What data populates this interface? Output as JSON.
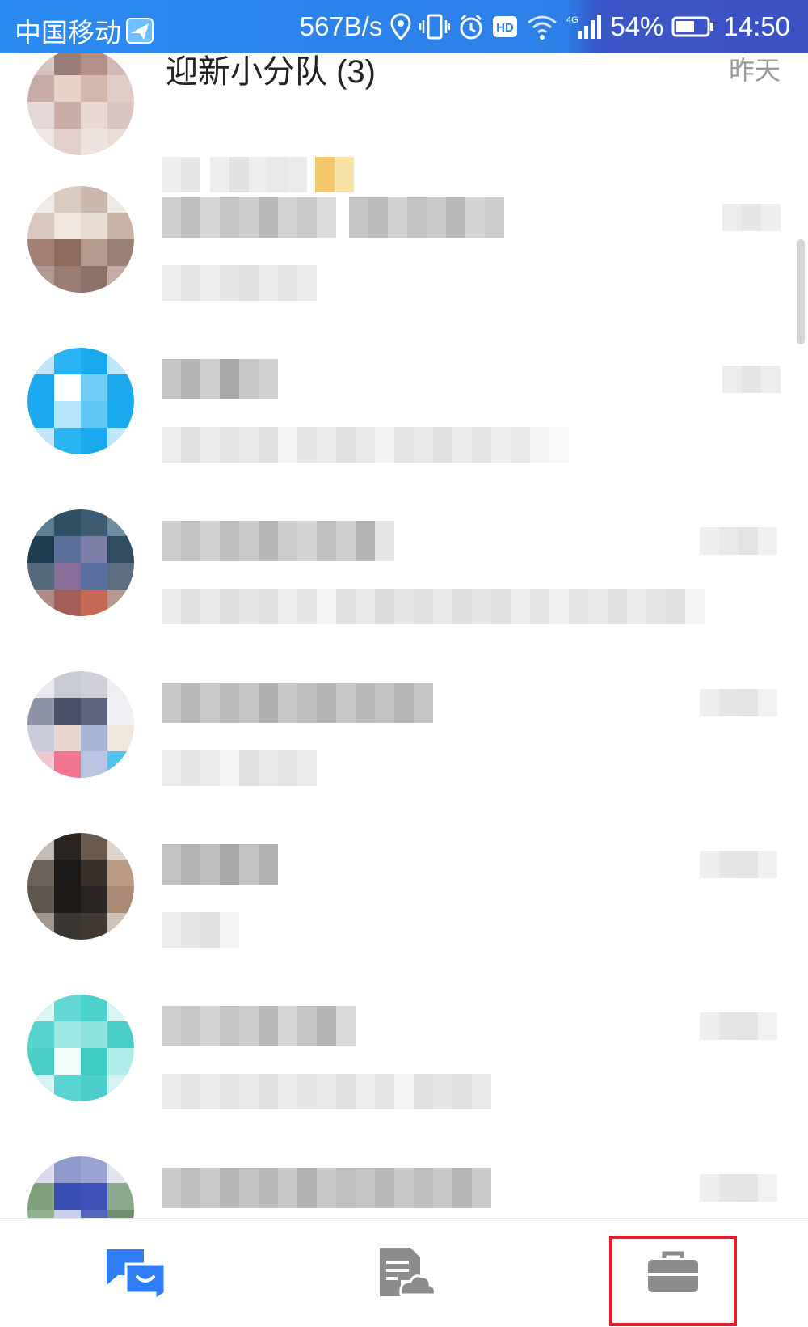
{
  "status_bar": {
    "carrier": "中国移动",
    "speed": "567B/s",
    "network": "4G",
    "battery": "54%",
    "time": "14:50",
    "colors": {
      "left": "#2a8bf2",
      "right": "#3a57c8"
    }
  },
  "chat_list": {
    "first_item": {
      "name": "迎新小分队 (3)",
      "time": "昨天"
    },
    "scrollbar": "visible"
  },
  "bottom_nav": {
    "items": [
      {
        "icon": "messages-icon",
        "active": true,
        "color": "#2f7df6"
      },
      {
        "icon": "docs-cloud-icon",
        "active": false,
        "color": "#8c8c8c"
      },
      {
        "icon": "workbench-icon",
        "active": false,
        "color": "#8c8c8c",
        "highlighted": true
      }
    ]
  }
}
